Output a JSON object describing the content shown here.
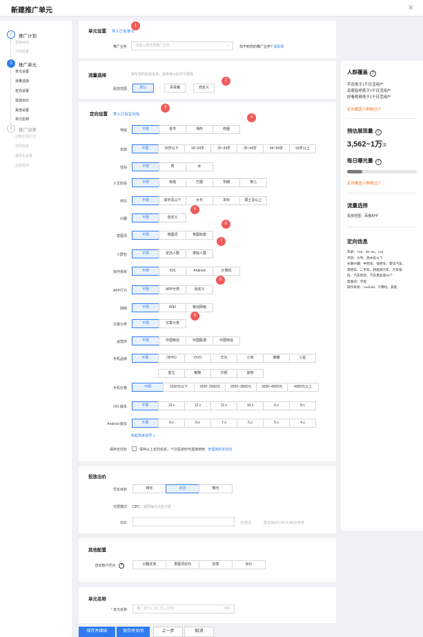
{
  "header": {
    "title": "新建推广单元",
    "close": "×"
  },
  "sidebar": {
    "steps": [
      {
        "num": "✓",
        "label": "推广计划",
        "subs": [
          "营销目标",
          "计划设置"
        ]
      },
      {
        "num": "2",
        "label": "推广单元",
        "subs": [
          "单元设置",
          "流量选择",
          "定向设置",
          "投放出价",
          "其他设置",
          "单元名称"
        ]
      },
      {
        "num": "3",
        "label": "推广创意",
        "subs": [
          "创意生成方式",
          "共同信息",
          "程序化设置",
          "创意组件"
        ]
      }
    ]
  },
  "unit_settings": {
    "title": "单元设置",
    "import_link": "导入已有单元",
    "business_label": "推广业务",
    "business_placeholder": "请输入或选择推广业务",
    "not_found_text": "找不到您的推广业务?",
    "feedback_link": "请反馈"
  },
  "traffic": {
    "title": "流量选择",
    "hint": "填写您的投放信息，保存单元后不可更改",
    "range_label": "投放范围",
    "options": [
      "默认",
      "百青藤",
      "自定义"
    ]
  },
  "targeting": {
    "title": "定向设置",
    "import_link": "导入已有定向包",
    "rows": [
      {
        "label": "地域",
        "options": [
          "不限",
          "省市",
          "场所",
          "商圈"
        ]
      },
      {
        "label": "年龄",
        "options": [
          "不限",
          "18岁以下",
          "18~24岁",
          "25~34岁",
          "35~44岁",
          "44~54岁",
          "54岁以上"
        ]
      },
      {
        "label": "性别",
        "options": [
          "不限",
          "男",
          "女"
        ]
      },
      {
        "label": "人生阶段",
        "options": [
          "不限",
          "未婚",
          "已婚",
          "孕期",
          "育儿"
        ]
      },
      {
        "label": "学历",
        "options": [
          "不限",
          "高中及以下",
          "大专",
          "本科",
          "硕士及以上"
        ]
      },
      {
        "label": "兴趣",
        "options": [
          "不限",
          "自定义"
        ]
      },
      {
        "label": "意图词",
        "options": [
          "不限",
          "意图词",
          "意图标签"
        ]
      },
      {
        "label": "人群包",
        "options": [
          "不限",
          "定向人群",
          "排除人群"
        ]
      },
      {
        "label": "操作系统",
        "options": [
          "不限",
          "iOS",
          "Andriod",
          "计算机"
        ]
      },
      {
        "label": "APP行为",
        "options": [
          "不限",
          "APP分类",
          "自定义"
        ]
      },
      {
        "label": "网络",
        "options": [
          "不限",
          "WIFI",
          "移动网络"
        ]
      },
      {
        "label": "文章分类",
        "options": [
          "不限",
          "文章分类"
        ]
      },
      {
        "label": "运营商",
        "options": [
          "不限",
          "中国移动",
          "中国联通",
          "中国电信"
        ]
      },
      {
        "label": "手机品牌",
        "options": [
          "不限",
          "OPPO",
          "VIVO",
          "华为",
          "小米",
          "荣耀",
          "三星"
        ],
        "options2": [
          "金立",
          "魅族",
          "乐视",
          "其他"
        ]
      },
      {
        "label": "手机价格",
        "options": [
          "不限",
          "1500元以下",
          "1500~2500元",
          "2500~3500元",
          "3500~4500元",
          "4000元以上"
        ]
      },
      {
        "label": "iOS 版本",
        "options": [
          "不限",
          "13.x",
          "12.x",
          "11.x",
          "10.x",
          "9.x",
          "8.x"
        ]
      },
      {
        "label": "Andriod 版本",
        "options": [
          "不限",
          "9.x",
          "8.x",
          "7.x",
          "6.x",
          "5.x",
          "4.x"
        ]
      }
    ],
    "collapse_link": "收起高级选项 ∧",
    "save_label": "保存定向包",
    "save_text": "保存以上定向信息，下次投放时可直接使用",
    "manage_link": "管理我的定向包"
  },
  "bidding": {
    "title": "投放出价",
    "goal_label": "优化目标",
    "goal_options": [
      "转化",
      "点击",
      "曝光"
    ],
    "pay_label": "付费模式",
    "pay_value": "CPC",
    "pay_hint": "按照每次点击计费",
    "bid_label": "出价",
    "bid_unit": "元/点击",
    "bid_suggest": "建议出价0.38~0.86元/点击"
  },
  "other": {
    "title": "其他配置",
    "auto_label": "自动账户优化",
    "options": [
      "兴趣定向",
      "意图词定向",
      "创意",
      "出价"
    ]
  },
  "unit_name": {
    "title": "单元名称",
    "label": "单元名称",
    "value": "推广单元1_03_03_10:50",
    "count": "0/50"
  },
  "footer": {
    "save_continue": "保存并继续",
    "save_close": "保存并关闭",
    "prev": "上一步",
    "cancel": "取消"
  },
  "right_panel": {
    "audience_title": "人群覆盖",
    "audience_lines": [
      "手百低于1千日活用户",
      "百度贴吧低于1千日活用户",
      "好看视频低于1千日活用户"
    ],
    "audience_warn": "定向覆盖人群数过少",
    "estimate_title": "预估展现量",
    "estimate_value": "3,562~1万",
    "estimate_unit": "次",
    "daily_title": "每日曝光量",
    "daily_progress": 0.22,
    "daily_warn": "定向覆盖人群数过少",
    "traffic_title": "流量选择",
    "traffic_text": "投放范围：百度APP",
    "target_title": "定向信息",
    "target_lines": [
      "年龄：<18，35~44，>44",
      "学历：大专、高中及以下",
      "长期兴趣：中档车、低档车、豪华汽车、",
      "高档车、二手车、新能源汽车、汽车保",
      "险、汽车改装、汽车用品等22个",
      "意图词：学黑",
      "操作系统：Android、计算机、其他"
    ]
  },
  "badges": [
    "1",
    "2",
    "3",
    "4",
    "5",
    "6",
    "7",
    "8",
    "9"
  ],
  "colors": {
    "accent": "#2f7bef",
    "badge": "#ef5a5a",
    "warn": "#f07c33"
  }
}
